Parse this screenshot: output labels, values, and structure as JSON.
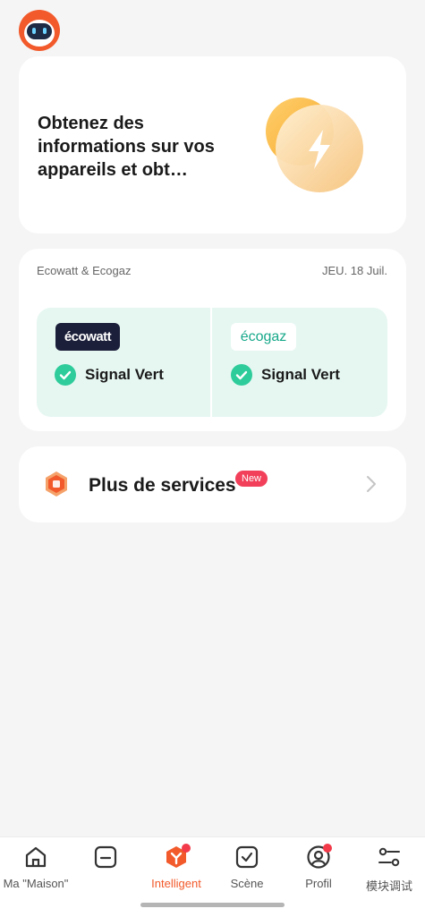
{
  "promo": {
    "text": "Obtenez des informations sur vos appareils et obt…"
  },
  "eco": {
    "title": "Ecowatt & Ecogaz",
    "date": "JEU. 18 Juil.",
    "ecowatt": {
      "logo_text": "écowatt",
      "signal": "Signal Vert"
    },
    "ecogaz": {
      "logo_text": "écogaz",
      "signal": "Signal Vert"
    }
  },
  "services": {
    "label": "Plus de services",
    "badge": "New"
  },
  "tabs": [
    {
      "label": "Ma \"Maison\"",
      "icon": "home-icon"
    },
    {
      "label": "",
      "icon": "minus-square-icon"
    },
    {
      "label": "Intelligent",
      "icon": "intelligent-icon",
      "active": true,
      "badge": true
    },
    {
      "label": "Scène",
      "icon": "check-square-icon"
    },
    {
      "label": "Profil",
      "icon": "profile-icon",
      "badge": true
    },
    {
      "label": "模块调试",
      "icon": "sliders-icon"
    }
  ],
  "colors": {
    "accent": "#f25a2b",
    "signal_green": "#2ecc9a",
    "badge_red": "#f2405a"
  }
}
